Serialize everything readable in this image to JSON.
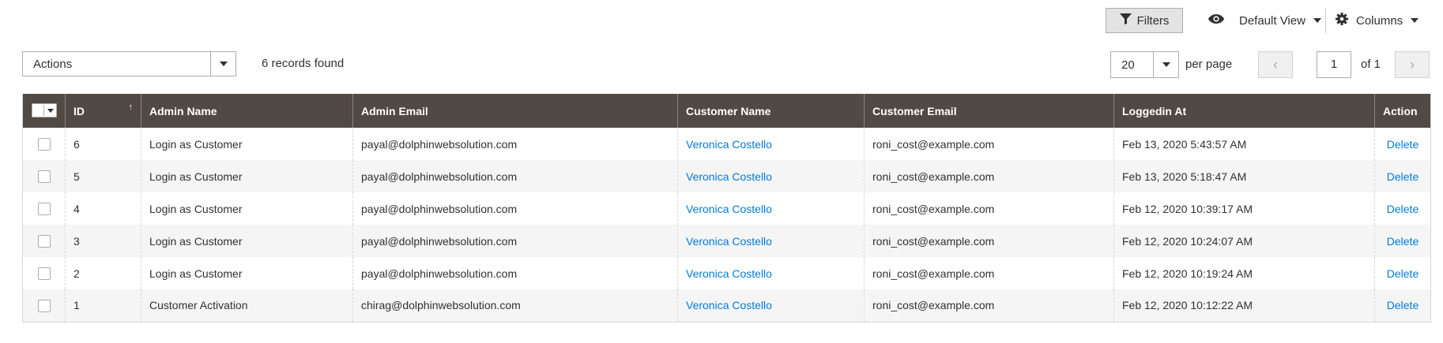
{
  "toolbar": {
    "filters_label": "Filters",
    "view_label": "Default View",
    "columns_label": "Columns"
  },
  "actions": {
    "selected": "Actions",
    "records_found": "6 records found"
  },
  "pager": {
    "per_page_value": "20",
    "per_page_label": "per page",
    "current_page": "1",
    "page_of": "of 1",
    "prev_glyph": "‹",
    "next_glyph": "›"
  },
  "grid": {
    "columns": [
      "ID",
      "Admin Name",
      "Admin Email",
      "Customer Name",
      "Customer Email",
      "Loggedin At",
      "Action"
    ],
    "sort_indicator": "↑",
    "rows": [
      {
        "id": "6",
        "admin_name": "Login as Customer",
        "admin_email": "payal@dolphinwebsolution.com",
        "customer_name": "Veronica Costello",
        "customer_email": "roni_cost@example.com",
        "loggedin_at": "Feb 13, 2020 5:43:57 AM",
        "action": "Delete"
      },
      {
        "id": "5",
        "admin_name": "Login as Customer",
        "admin_email": "payal@dolphinwebsolution.com",
        "customer_name": "Veronica Costello",
        "customer_email": "roni_cost@example.com",
        "loggedin_at": "Feb 13, 2020 5:18:47 AM",
        "action": "Delete"
      },
      {
        "id": "4",
        "admin_name": "Login as Customer",
        "admin_email": "payal@dolphinwebsolution.com",
        "customer_name": "Veronica Costello",
        "customer_email": "roni_cost@example.com",
        "loggedin_at": "Feb 12, 2020 10:39:17 AM",
        "action": "Delete"
      },
      {
        "id": "3",
        "admin_name": "Login as Customer",
        "admin_email": "payal@dolphinwebsolution.com",
        "customer_name": "Veronica Costello",
        "customer_email": "roni_cost@example.com",
        "loggedin_at": "Feb 12, 2020 10:24:07 AM",
        "action": "Delete"
      },
      {
        "id": "2",
        "admin_name": "Login as Customer",
        "admin_email": "payal@dolphinwebsolution.com",
        "customer_name": "Veronica Costello",
        "customer_email": "roni_cost@example.com",
        "loggedin_at": "Feb 12, 2020 10:19:24 AM",
        "action": "Delete"
      },
      {
        "id": "1",
        "admin_name": "Customer Activation",
        "admin_email": "chirag@dolphinwebsolution.com",
        "customer_name": "Veronica Costello",
        "customer_email": "roni_cost@example.com",
        "loggedin_at": "Feb 12, 2020 10:12:22 AM",
        "action": "Delete"
      }
    ]
  },
  "icons": {
    "filter": "filter-icon",
    "view": "eye-icon",
    "columns": "gear-icon"
  },
  "colors": {
    "header_bg": "#514943",
    "link": "#007bdb",
    "row_alt": "#f5f5f5"
  }
}
